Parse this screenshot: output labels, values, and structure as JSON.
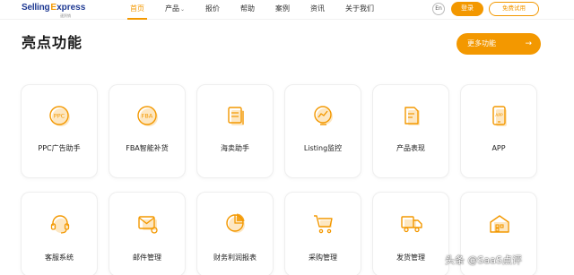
{
  "brand": {
    "logo_selling": "Selling",
    "logo_express_e": "E",
    "logo_express_rest": "xpress",
    "logo_subtitle": "速贸销"
  },
  "nav": {
    "items": [
      {
        "label": "首页",
        "active": true
      },
      {
        "label": "产品",
        "has_dropdown": true
      },
      {
        "label": "报价"
      },
      {
        "label": "帮助"
      },
      {
        "label": "案例"
      },
      {
        "label": "资讯"
      },
      {
        "label": "关于我们"
      }
    ],
    "lang_label": "En",
    "login_label": "登录",
    "trial_label": "免费试用"
  },
  "section": {
    "title": "亮点功能",
    "more_label": "更多功能",
    "more_arrow": "→"
  },
  "features": [
    {
      "label": "PPC广告助手",
      "icon": "ppc-icon",
      "icon_text": "PPC"
    },
    {
      "label": "FBA智能补货",
      "icon": "fba-icon",
      "icon_text": "FBA"
    },
    {
      "label": "海卖助手",
      "icon": "document-stack-icon"
    },
    {
      "label": "Listing监控",
      "icon": "monitor-chart-icon"
    },
    {
      "label": "产品表现",
      "icon": "report-icon"
    },
    {
      "label": "APP",
      "icon": "mobile-app-icon",
      "icon_text": "APP"
    },
    {
      "label": "客服系统",
      "icon": "headset-icon"
    },
    {
      "label": "邮件管理",
      "icon": "mail-gear-icon"
    },
    {
      "label": "财务利润报表",
      "icon": "pie-chart-icon"
    },
    {
      "label": "采购管理",
      "icon": "shopping-cart-icon"
    },
    {
      "label": "发货管理",
      "icon": "delivery-truck-icon"
    },
    {
      "label": "",
      "icon": "warehouse-icon"
    }
  ],
  "watermark": {
    "text": "头条 @SaaS点评"
  },
  "colors": {
    "accent": "#f39800",
    "brand_blue": "#1f3a93",
    "icon_fill": "#fde7c2"
  }
}
